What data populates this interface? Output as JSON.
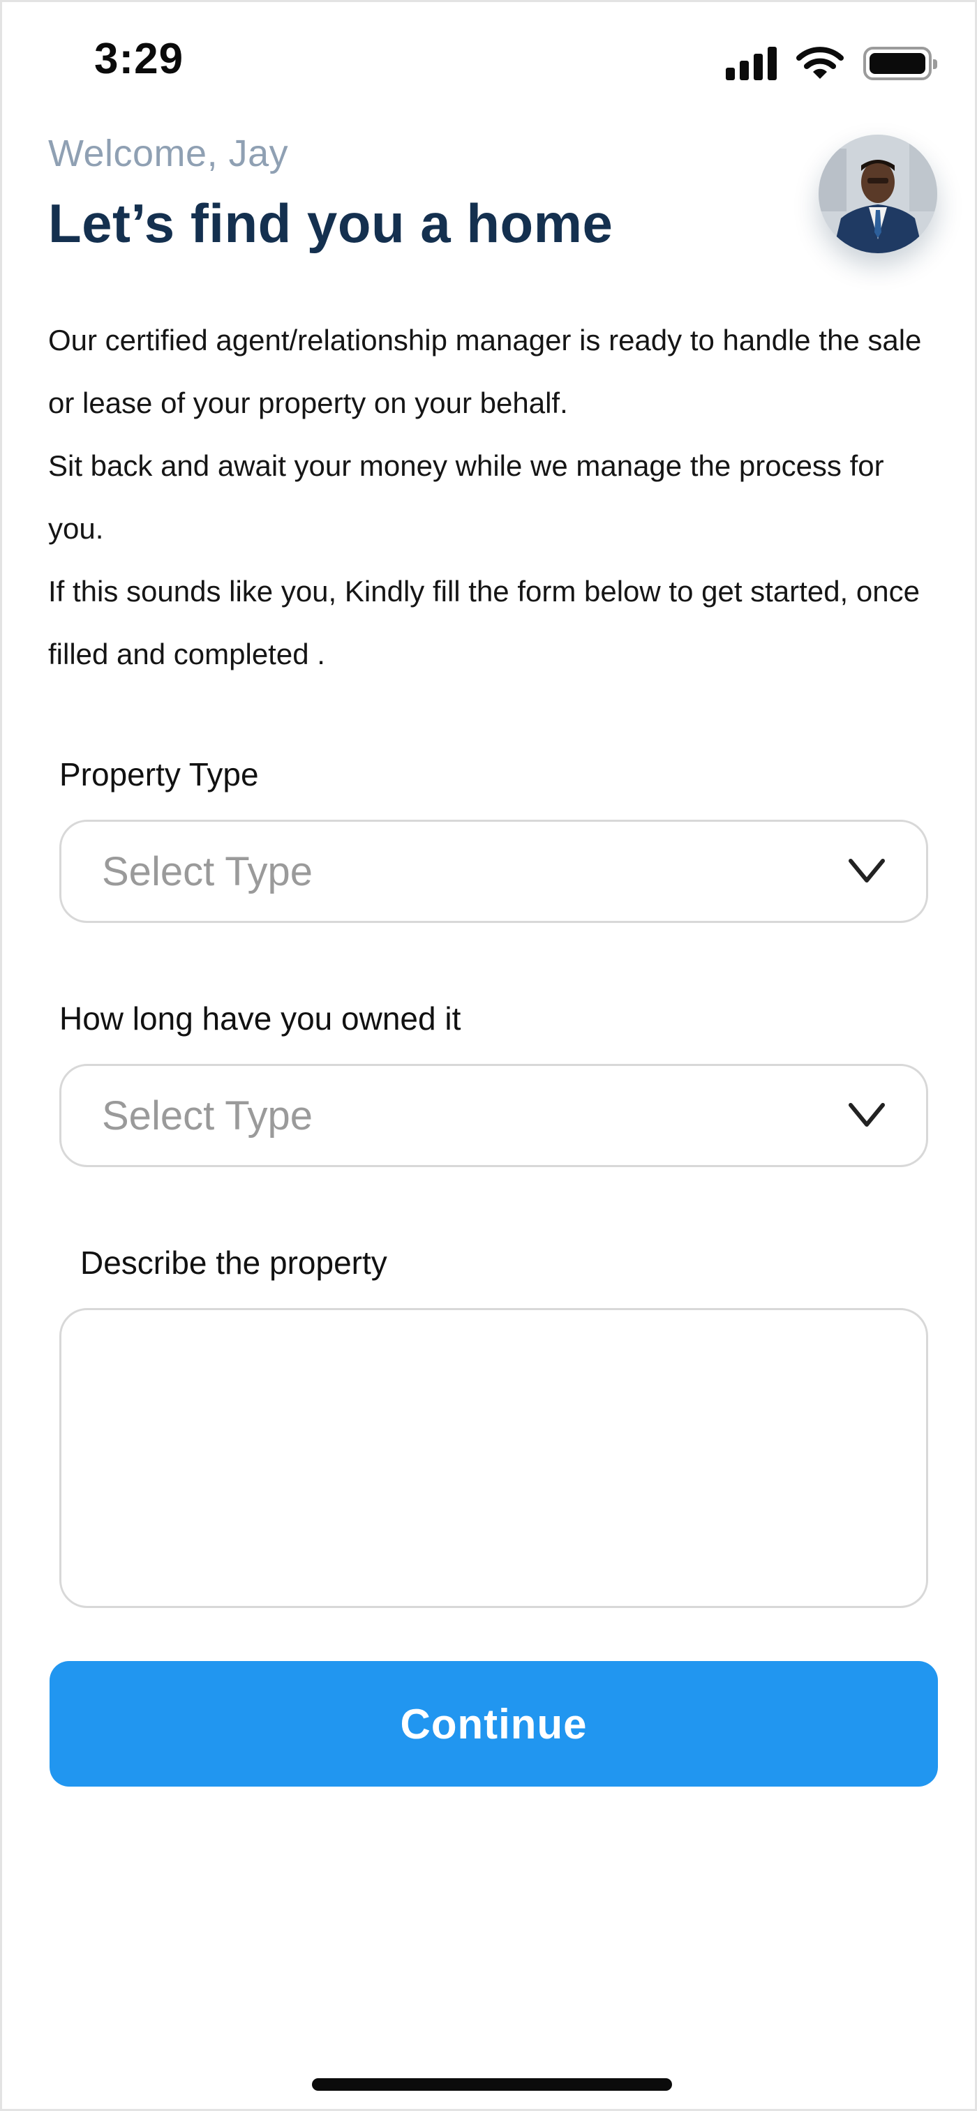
{
  "status_bar": {
    "time": "3:29",
    "icons": [
      "signal-icon",
      "wifi-icon",
      "battery-icon"
    ]
  },
  "header": {
    "welcome": "Welcome, Jay",
    "title": "Let’s find you a home"
  },
  "intro": {
    "line1": "Our certified agent/relationship manager is ready to handle the sale or lease of your property on your behalf.",
    "line2": "Sit back and await your money while we manage the process for you.",
    "line3": "If this sounds like you, Kindly fill the form below to get started, once filled and completed ."
  },
  "form": {
    "property_type": {
      "label": "Property Type",
      "value": "Select Type"
    },
    "ownership_duration": {
      "label": "How long have you owned it",
      "value": "Select Type"
    },
    "description": {
      "label": "Describe the property",
      "value": ""
    }
  },
  "actions": {
    "continue_label": "Continue"
  },
  "colors": {
    "accent": "#2196f0",
    "title": "#14304f",
    "welcome": "#8fa0b3",
    "placeholder": "#9a9a9a",
    "border": "#d8d8d8"
  }
}
